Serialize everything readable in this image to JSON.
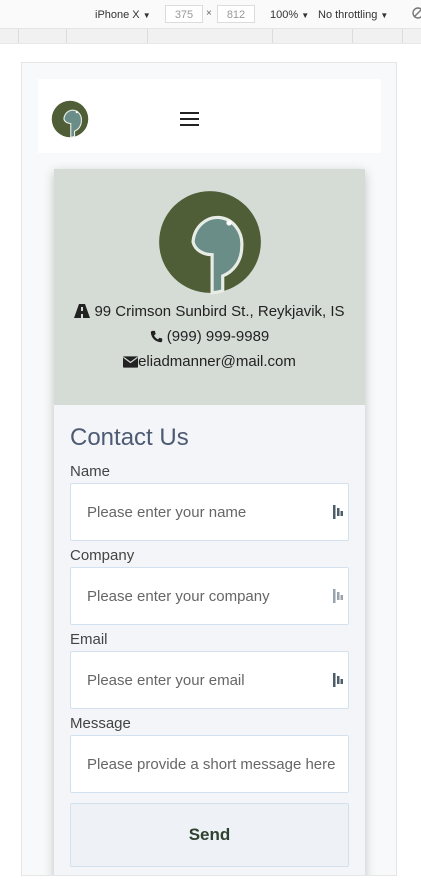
{
  "devtools": {
    "device": "iPhone X",
    "width": "375",
    "height": "812",
    "times": "×",
    "zoom": "100%",
    "throttling": "No throttling"
  },
  "nav": {
    "brand_icon": "elephant-logo-icon",
    "menu_icon": "hamburger-menu-icon"
  },
  "contact_info": {
    "address": "99 Crimson Sunbird St., Reykjavik, IS",
    "phone": "(999) 999-9989",
    "email": "eliadmanner@mail.com"
  },
  "form": {
    "title": "Contact Us",
    "name_label": "Name",
    "name_placeholder": "Please enter your name",
    "company_label": "Company",
    "company_placeholder": "Please enter your company",
    "email_label": "Email",
    "email_placeholder": "Please enter your email",
    "message_label": "Message",
    "message_placeholder": "Please provide a short message here",
    "send_label": "Send"
  },
  "colors": {
    "logo_dark": "#4f5e36",
    "logo_light": "#6a8d87",
    "header_bg": "#d5dcd6",
    "title": "#4d5a73",
    "send_text": "#2f4230"
  }
}
